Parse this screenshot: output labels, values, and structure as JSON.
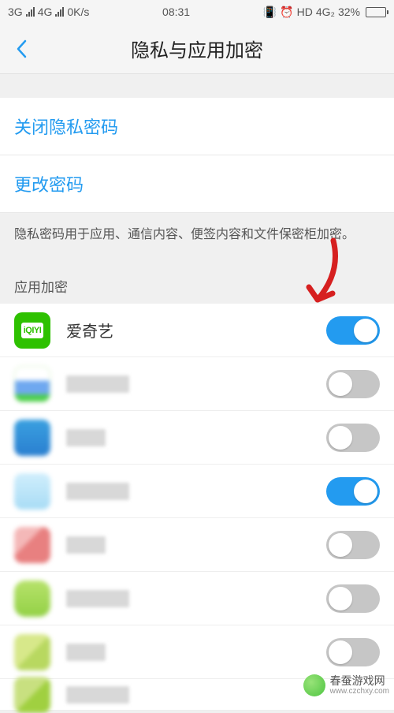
{
  "status": {
    "left_net1": "3G",
    "left_net2": "4G",
    "speed": "0K/s",
    "time": "08:31",
    "right_hd": "HD",
    "right_net": "4G₂",
    "battery_pct": "32%"
  },
  "header": {
    "title": "隐私与应用加密"
  },
  "links": {
    "disable_password": "关闭隐私密码",
    "change_password": "更改密码"
  },
  "description": "隐私密码用于应用、通信内容、便签内容和文件保密柜加密。",
  "section_label": "应用加密",
  "apps": [
    {
      "name": "爱奇艺",
      "toggled": true,
      "icon_class": "icon-iqiyi",
      "blurred": false
    },
    {
      "name": "",
      "toggled": false,
      "icon_class": "blur-icon bi1",
      "blurred": true
    },
    {
      "name": "",
      "toggled": false,
      "icon_class": "blur-icon bi2",
      "blurred": true
    },
    {
      "name": "",
      "toggled": true,
      "icon_class": "blur-icon bi3",
      "blurred": true
    },
    {
      "name": "",
      "toggled": false,
      "icon_class": "blur-icon bi4",
      "blurred": true
    },
    {
      "name": "",
      "toggled": false,
      "icon_class": "blur-icon bi5",
      "blurred": true
    },
    {
      "name": "",
      "toggled": false,
      "icon_class": "blur-icon bi6",
      "blurred": true
    },
    {
      "name": "",
      "toggled": false,
      "icon_class": "blur-icon bi7",
      "blurred": true,
      "partial": true
    }
  ],
  "watermark": {
    "line1": "春蚕游戏网",
    "line2": "www.czchxy.com"
  }
}
